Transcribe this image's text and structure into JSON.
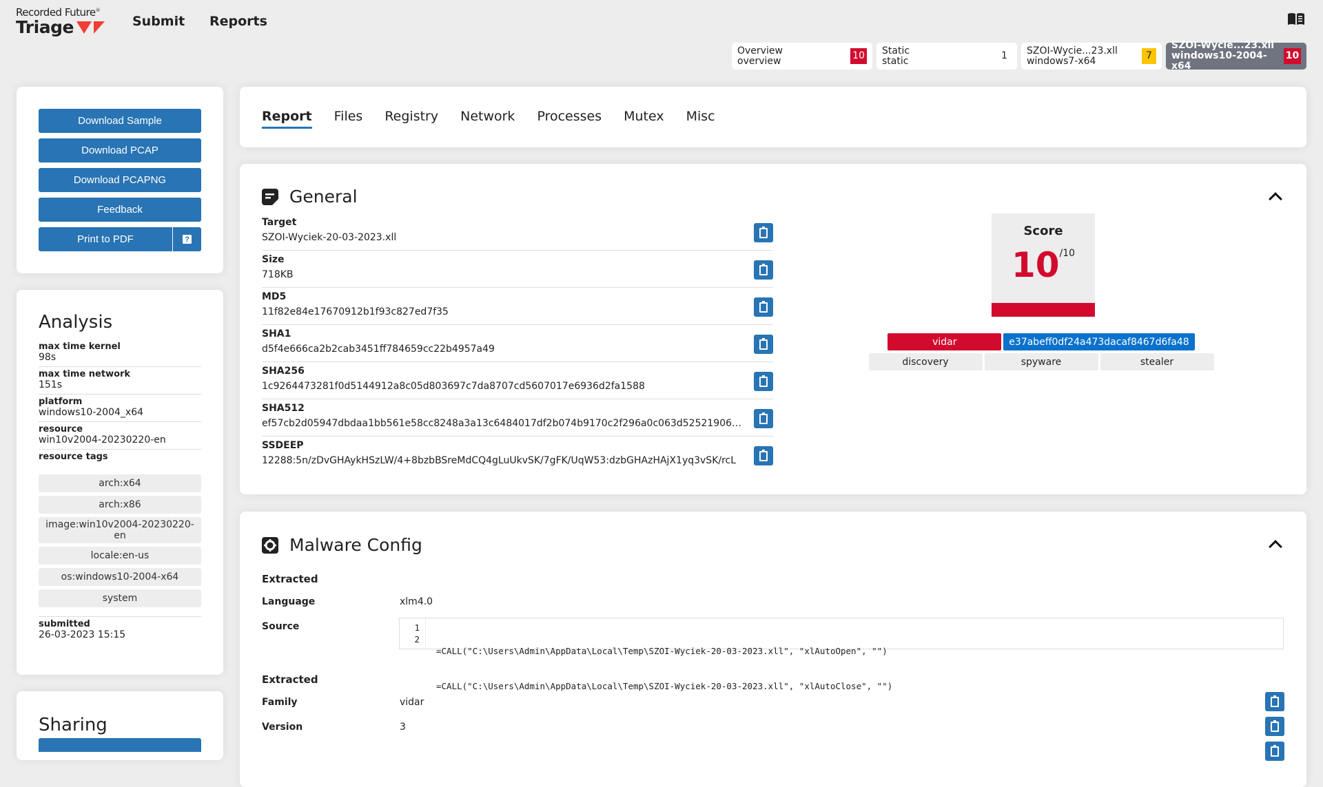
{
  "header": {
    "brand_top": "Recorded Future",
    "brand_bottom": "Triage",
    "nav": [
      "Submit",
      "Reports"
    ]
  },
  "sample_tabs": [
    {
      "line1": "Overview",
      "line2": "overview",
      "score": "10",
      "level": "red",
      "active": false
    },
    {
      "line1": "Static",
      "line2": "static",
      "score": "1",
      "level": "none",
      "active": false
    },
    {
      "line1": "SZOI-Wycie...23.xll",
      "line2": "windows7-x64",
      "score": "7",
      "level": "yellow",
      "active": false
    },
    {
      "line1": "SZOI-Wycie...23.xll",
      "line2": "windows10-2004-x64",
      "score": "10",
      "level": "red",
      "active": true
    }
  ],
  "actions": {
    "download_sample": "Download Sample",
    "download_pcap": "Download PCAP",
    "download_pcapng": "Download PCAPNG",
    "feedback": "Feedback",
    "print_pdf": "Print to PDF",
    "help": "?"
  },
  "analysis": {
    "title": "Analysis",
    "items": [
      {
        "key": "max time kernel",
        "value": "98s"
      },
      {
        "key": "max time network",
        "value": "151s"
      },
      {
        "key": "platform",
        "value": "windows10-2004_x64"
      },
      {
        "key": "resource",
        "value": "win10v2004-20230220-en"
      }
    ],
    "resource_tags_label": "resource tags",
    "resource_tags": [
      "arch:x64",
      "arch:x86",
      "image:win10v2004-20230220-en",
      "locale:en-us",
      "os:windows10-2004-x64",
      "system"
    ],
    "submitted_label": "submitted",
    "submitted_value": "26-03-2023 15:15"
  },
  "sharing": {
    "title": "Sharing"
  },
  "report_tabs": [
    "Report",
    "Files",
    "Registry",
    "Network",
    "Processes",
    "Mutex",
    "Misc"
  ],
  "general": {
    "title": "General",
    "rows": [
      {
        "key": "Target",
        "value": "SZOI-Wyciek-20-03-2023.xll"
      },
      {
        "key": "Size",
        "value": "718KB"
      },
      {
        "key": "MD5",
        "value": "11f82e84e17670912b1f93c827ed7f35"
      },
      {
        "key": "SHA1",
        "value": "d5f4e666ca2b2cab3451ff784659cc22b4957a49"
      },
      {
        "key": "SHA256",
        "value": "1c9264473281f0d5144912a8c05d803697c7da8707cd5607017e6936d2fa1588"
      },
      {
        "key": "SHA512",
        "value": "ef57cb2d05947dbdaa1bb561e58cc8248a3a13c6484017df2b074b9170c2f296a0c063d5252190662e66..."
      },
      {
        "key": "SSDEEP",
        "value": "12288:5n/zDvGHAykHSzLW/4+8bzbBSreMdCQ4gLuUkvSK/7gFK/UqW53:dzbGHAzHAjX1yq3vSK/rcL"
      }
    ],
    "score_label": "Score",
    "score": "10",
    "score_max": "/10",
    "score_fraction": 1.0,
    "tags": [
      {
        "label": "vidar",
        "style": "red"
      },
      {
        "label": "e37abeff0df24a473dacaf8467d6fa48",
        "style": "blue"
      },
      {
        "label": "discovery",
        "style": "grey"
      },
      {
        "label": "spyware",
        "style": "grey"
      },
      {
        "label": "stealer",
        "style": "grey"
      }
    ]
  },
  "malware_config": {
    "title": "Malware Config",
    "extracted1_label": "Extracted",
    "language_label": "Language",
    "language_value": "xlm4.0",
    "source_label": "Source",
    "source_lines": [
      "=CALL(\"C:\\Users\\Admin\\AppData\\Local\\Temp\\SZOI-Wyciek-20-03-2023.xll\", \"xlAutoOpen\", \"\")",
      "=CALL(\"C:\\Users\\Admin\\AppData\\Local\\Temp\\SZOI-Wyciek-20-03-2023.xll\", \"xlAutoClose\", \"\")"
    ],
    "extracted2_label": "Extracted",
    "family_label": "Family",
    "family_value": "vidar",
    "version_label": "Version",
    "version_value": "3"
  }
}
